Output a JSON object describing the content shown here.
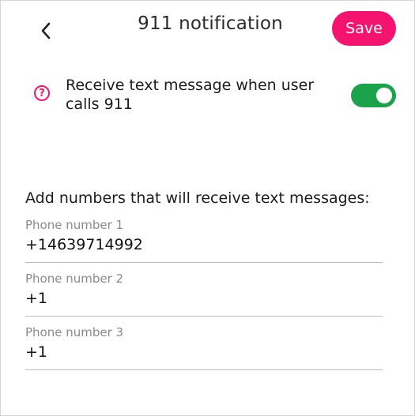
{
  "colors": {
    "accent": "#f4146f",
    "toggle_on": "#1aa34a"
  },
  "header": {
    "back_icon": "chevron-left-icon",
    "title": "911 notification",
    "save_label": "Save"
  },
  "toggle": {
    "help_icon": "question-circle-icon",
    "help_glyph": "?",
    "label": "Receive text message when user calls 911",
    "enabled": true
  },
  "numbers": {
    "heading": "Add numbers that will receive text messages:",
    "fields": [
      {
        "label": "Phone number 1",
        "value": "+14639714992"
      },
      {
        "label": "Phone number 2",
        "value": "+1"
      },
      {
        "label": "Phone number 3",
        "value": "+1"
      }
    ]
  }
}
